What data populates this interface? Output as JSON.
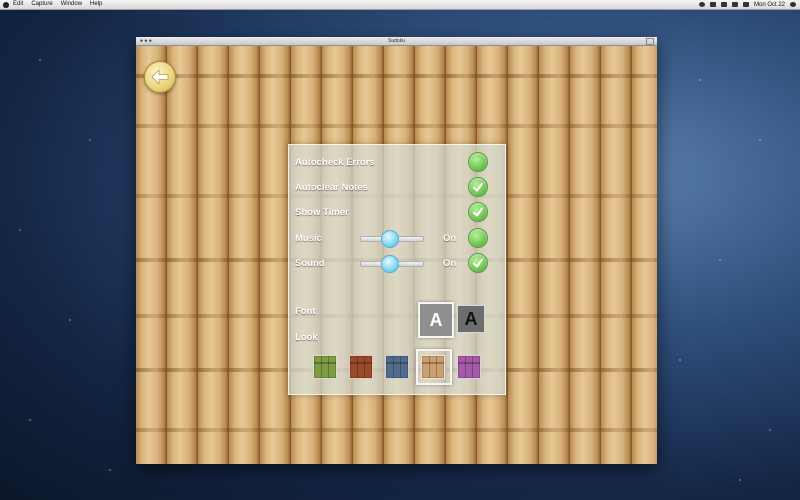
{
  "menubar": {
    "items": [
      "Edit",
      "Capture",
      "Window",
      "Help"
    ],
    "clock": "Mon Oct 22"
  },
  "window": {
    "title": "Sudoku"
  },
  "settings": {
    "autocheck_errors": "Autocheck Errors",
    "autoclear_notes": "Autoclear Notes",
    "show_timer": "Show Timer",
    "music": "Music",
    "sound": "Sound",
    "music_state": "On",
    "sound_state": "On",
    "font": "Font",
    "look": "Look",
    "font_option_a": "A",
    "font_option_b": "A",
    "music_level": 0.45,
    "sound_level": 0.45
  },
  "colors": {
    "check_green": "#73c855",
    "knob_blue": "#88d8f5",
    "look_green": "#7e9b45",
    "look_red": "#9a4a2a",
    "look_blue": "#4f6c8a",
    "look_tan": "#caa072",
    "look_purple": "#a45aa8"
  }
}
